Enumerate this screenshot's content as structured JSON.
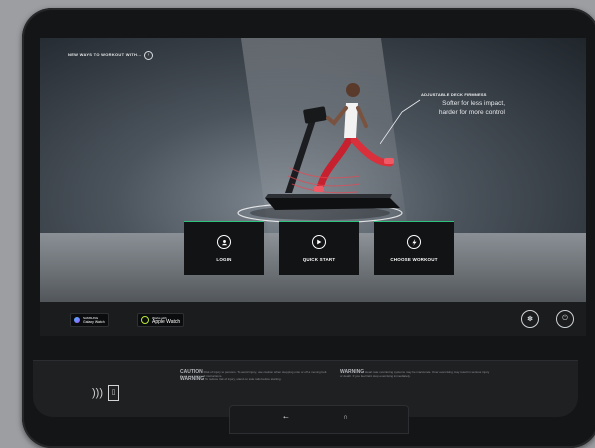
{
  "screen": {
    "header_text": "NEW WAYS TO WORKOUT WITH...",
    "callout": {
      "title": "ADJUSTABLE DECK FIRMNESS",
      "line1": "Softer for less impact,",
      "line2": "harder for more control"
    },
    "tiles": [
      {
        "label": "LOGIN",
        "icon": "user-icon"
      },
      {
        "label": "QUICK START",
        "icon": "play-icon"
      },
      {
        "label": "CHOOSE WORKOUT",
        "icon": "bolt-icon"
      }
    ]
  },
  "bottom_bar": {
    "badges": [
      {
        "line1": "SAMSUNG",
        "line2": "Galaxy Watch"
      },
      {
        "line1": "Works with",
        "line2": "Apple Watch"
      }
    ],
    "buttons": [
      {
        "icon": "fan-icon"
      },
      {
        "icon": "power-icon"
      }
    ]
  },
  "console": {
    "caution_title": "CAUTION",
    "caution_text": "Risk of injury to persons. To avoid injury, use caution when stepping onto or off a moving belt. Read and follow all instructions.",
    "warning_title_left": "WARNING",
    "warning_text_left": "To reduce risk of injury, stand on side rails before starting.",
    "warning_title_right": "WARNING",
    "warning_text_right": "Heart rate monitoring systems may be inaccurate. Over exercising may result in serious injury or death. If you feel faint stop exercising immediately."
  },
  "colors": {
    "accent": "#2ec27e",
    "tile_bg": "#121315",
    "bezel": "#141517"
  }
}
